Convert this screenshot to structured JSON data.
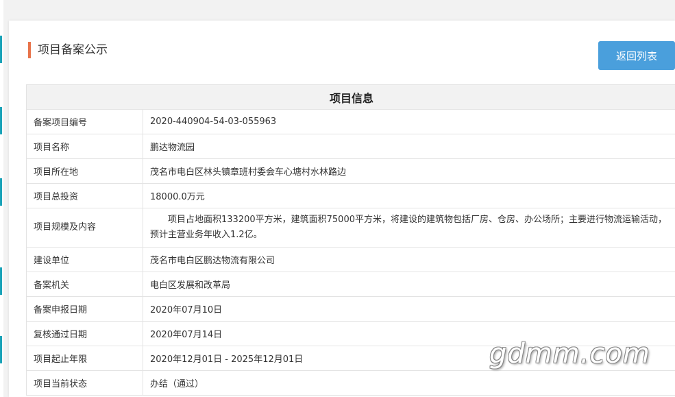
{
  "page": {
    "title": "项目备案公示",
    "back_button": "返回列表"
  },
  "table": {
    "header": "项目信息",
    "rows": [
      {
        "label": "备案项目编号",
        "value": "2020-440904-54-03-055963"
      },
      {
        "label": "项目名称",
        "value": "鹏达物流园"
      },
      {
        "label": "项目所在地",
        "value": "茂名市电白区林头镇章班村委会车心塘村水林路边"
      },
      {
        "label": "项目总投资",
        "value": "18000.0万元"
      },
      {
        "label": "项目规模及内容",
        "value": "项目占地面积133200平方米，建筑面积75000平方米，将建设的建筑物包括厂房、仓房、办公场所；主要进行物流运输活动，预计主营业务年收入1.2亿。"
      },
      {
        "label": "建设单位",
        "value": "茂名市电白区鹏达物流有限公司"
      },
      {
        "label": "备案机关",
        "value": "电白区发展和改革局"
      },
      {
        "label": "备案申报日期",
        "value": "2020年07月10日"
      },
      {
        "label": "复核通过日期",
        "value": "2020年07月14日"
      },
      {
        "label": "项目起止年限",
        "value": "2020年12月01日 - 2025年12月01日"
      },
      {
        "label": "项目当前状态",
        "value": "办结（通过）"
      }
    ]
  },
  "watermark": "gdmm.com",
  "colors": {
    "accent": "#e8734a",
    "button": "#4a9fdc",
    "header_bg": "#f2f2f2"
  }
}
